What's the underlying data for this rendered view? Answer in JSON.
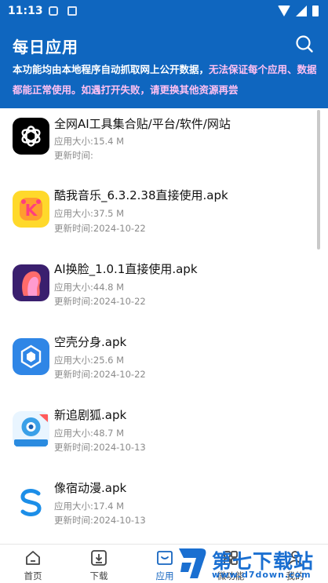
{
  "status_bar": {
    "time": "11:13"
  },
  "header": {
    "title": "每日应用",
    "notice_plain": "本功能均由本地程序自动抓取网上公开数据，",
    "notice_highlight": "无法保证每个应用、数据都能正常使用。如遇打开失败，请更换其他资源再尝"
  },
  "labels": {
    "size_prefix": "应用大小:",
    "updated_prefix": "更新时间:"
  },
  "apps": [
    {
      "name": "全网AI工具集合贴/平台/软件/网站",
      "size": "15.4 M",
      "updated": "",
      "icon": "openai-logo-icon"
    },
    {
      "name": "酷我音乐_6.3.2.38直接使用.apk",
      "size": "37.5 M",
      "updated": "2024-10-22",
      "icon": "kuwo-music-icon"
    },
    {
      "name": "AI换脸_1.0.1直接使用.apk",
      "size": "44.8 M",
      "updated": "2024-10-22",
      "icon": "ai-face-swap-icon"
    },
    {
      "name": "空壳分身.apk",
      "size": "25.6 M",
      "updated": "2024-10-22",
      "icon": "cube-clone-icon"
    },
    {
      "name": "新追剧狐.apk",
      "size": "48.7 M",
      "updated": "2024-10-13",
      "icon": "fox-drama-icon"
    },
    {
      "name": "像宿动漫.apk",
      "size": "17.4 M",
      "updated": "2024-10-13",
      "icon": "anime-s-icon"
    }
  ],
  "nav": [
    {
      "label": "首页",
      "icon": "home-icon"
    },
    {
      "label": "下载",
      "icon": "download-icon"
    },
    {
      "label": "应用",
      "icon": "apps-icon"
    },
    {
      "label": "微功能",
      "icon": "tools-icon"
    },
    {
      "label": "我的",
      "icon": "profile-icon"
    }
  ],
  "watermark": {
    "text": "第七下载站",
    "url": "www.d7down.com"
  },
  "colors": {
    "header_bg": "#0f66bf",
    "highlight": "#ffc0f2",
    "accent": "#1565c0"
  }
}
